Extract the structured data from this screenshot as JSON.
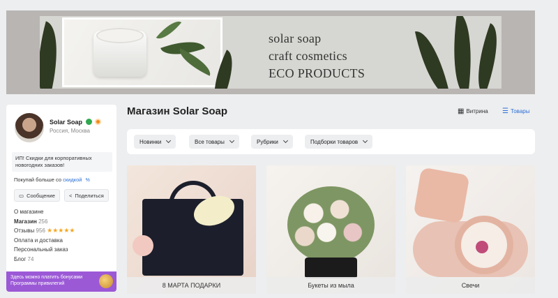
{
  "banner": {
    "lines": [
      "solar soap",
      "craft cosmetics",
      "ECO PRODUCTS"
    ]
  },
  "shop": {
    "name": "Solar Soap",
    "location": "Россия, Москва",
    "promo": "ИП! Скидки для корпоративных новогодних заказов!",
    "buy_more_text": "Покупай больше со",
    "buy_more_link": "скидкой",
    "message_btn": "Сообщение",
    "share_btn": "Поделиться",
    "menu": {
      "about": "О магазине",
      "shop": "Магазин",
      "shop_count": "256",
      "reviews": "Отзывы",
      "reviews_count": "956",
      "stars": "★★★★★",
      "payment": "Оплата и доставка",
      "custom": "Персональный заказ",
      "blog": "Блог",
      "blog_count": "74"
    },
    "bonus": "Здесь можно платить бонусами Программы привилегий"
  },
  "main": {
    "title": "Магазин Solar Soap",
    "view_showcase": "Витрина",
    "view_goods": "Товары",
    "filters": [
      "Новинки",
      "Все товары",
      "Рубрики",
      "Подборки товаров"
    ],
    "tiles": [
      "8 МАРТА ПОДАРКИ",
      "Букеты из мыла",
      "Свечи"
    ]
  },
  "colors": {
    "accent": "#2a6fd6",
    "bonus": "#9b59d6",
    "star": "#f5a623"
  }
}
